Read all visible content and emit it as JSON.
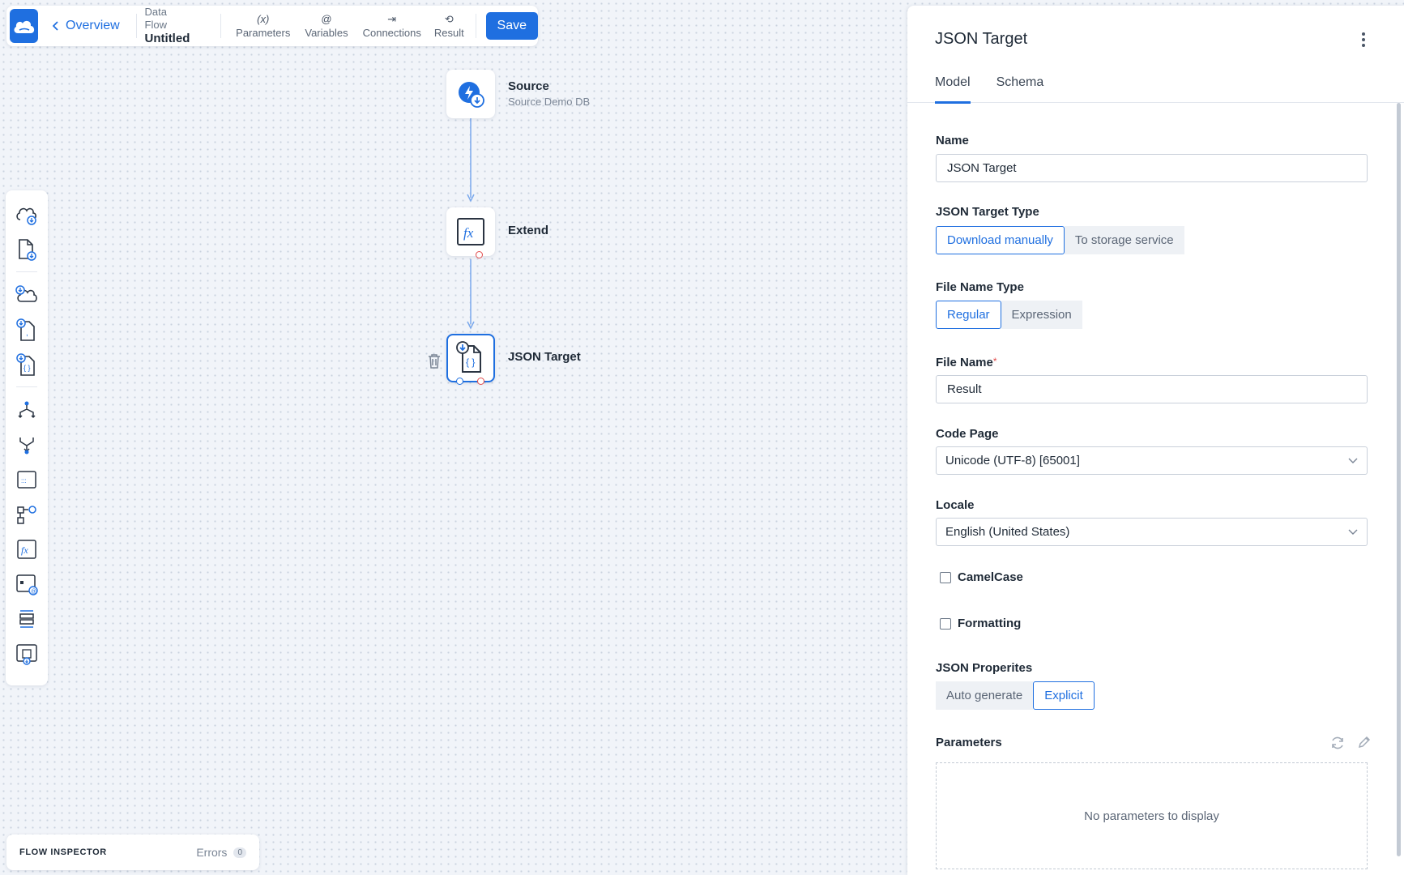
{
  "toolbar": {
    "back_label": "Overview",
    "flow_type": "Data Flow",
    "flow_name": "Untitled",
    "buttons": [
      {
        "icon_glyph": "(x)",
        "label": "Parameters"
      },
      {
        "icon_glyph": "@",
        "label": "Variables"
      },
      {
        "icon_glyph": "⇥",
        "label": "Connections"
      },
      {
        "icon_glyph": "⟲",
        "label": "Result"
      }
    ],
    "save_label": "Save",
    "accent": "#1f6fe0"
  },
  "canvas": {
    "nodes": [
      {
        "label": "Source",
        "sublabel": "Source Demo DB",
        "icon": "source-icon"
      },
      {
        "label": "Extend",
        "sublabel": "",
        "icon": "fx-icon"
      },
      {
        "label": "JSON Target",
        "sublabel": "",
        "icon": "json-file-icon",
        "selected": true
      }
    ]
  },
  "palette": {
    "icons": [
      "cloud-source-icon",
      "file-source-icon",
      "cloud-target-icon",
      "csv-target-icon",
      "json-target-icon",
      "split-icon",
      "merge-icon",
      "lookup-icon",
      "join-icon",
      "fx-icon",
      "variable-icon",
      "stack-icon",
      "nested-target-icon"
    ]
  },
  "inspector": {
    "title": "FLOW INSPECTOR",
    "errors_label": "Errors",
    "errors_count": "0"
  },
  "panel": {
    "title": "JSON Target",
    "tabs": [
      {
        "label": "Model",
        "active": true
      },
      {
        "label": "Schema",
        "active": false
      }
    ],
    "name_label": "Name",
    "name_value": "JSON Target",
    "target_type_label": "JSON Target Type",
    "target_type_options": [
      "Download manually",
      "To storage service"
    ],
    "file_name_type_label": "File Name Type",
    "file_name_type_options": [
      "Regular",
      "Expression"
    ],
    "file_name_label": "File Name",
    "file_name_required": "*",
    "file_name_value": "Result",
    "code_page_label": "Code Page",
    "code_page_value": "Unicode (UTF-8) [65001]",
    "locale_label": "Locale",
    "locale_value": "English (United States)",
    "camelcase_label": "CamelCase",
    "formatting_label": "Formatting",
    "json_props_label": "JSON Properites",
    "json_props_options": [
      "Auto generate",
      "Explicit"
    ],
    "parameters_label": "Parameters",
    "parameters_empty": "No parameters to display"
  }
}
